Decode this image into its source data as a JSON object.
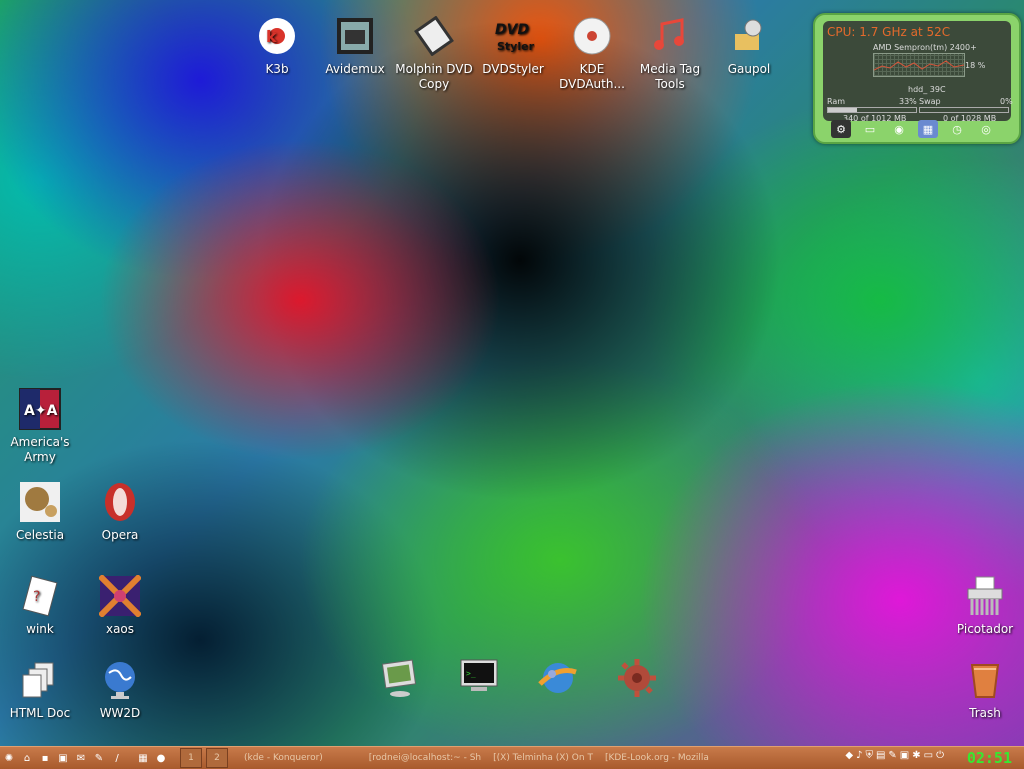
{
  "desktop_icons": {
    "k3b": "K3b",
    "avidemux": "Avidemux",
    "molphin": "Molphin DVD Copy",
    "dvdstyler": "DVDStyler",
    "kde_dvdauth": "KDE DVDAuth...",
    "media_tag": "Media Tag Tools",
    "gaupol": "Gaupol",
    "americas_army": "America's Army",
    "celestia": "Celestia",
    "opera": "Opera",
    "wink": "wink",
    "xaos": "xaos",
    "html_doc": "HTML Doc",
    "ww2d": "WW2D",
    "picotador": "Picotador",
    "trash": "Trash"
  },
  "sysmon": {
    "cpu": "CPU: 1.7 GHz at 52C",
    "model": "AMD Sempron(tm) 2400+",
    "cpu_load": "18 %",
    "hdd": "hdd_ 39C",
    "ram_label": "Ram",
    "ram_pct": "33%",
    "swap_label": "Swap",
    "swap_pct": "0%",
    "ram_value": "340 of 1012 MB",
    "swap_value": "0 of 1028 MB",
    "ram_fraction": 0.33,
    "swap_fraction": 0.0
  },
  "taskbar": {
    "desktops": [
      "1",
      "2"
    ],
    "tasks": [
      "(kde - Konqueror)",
      "[rodnei@localhost:~ - Sh",
      "[(X) Telminha (X) On T",
      "[KDE-Look.org - Mozilla"
    ],
    "clock": "02:51"
  },
  "colors": {
    "taskbar": "#b8693a",
    "clock": "#38e830",
    "sysmon_frame": "#8bd36b",
    "cpu_text": "#e36a2c"
  }
}
